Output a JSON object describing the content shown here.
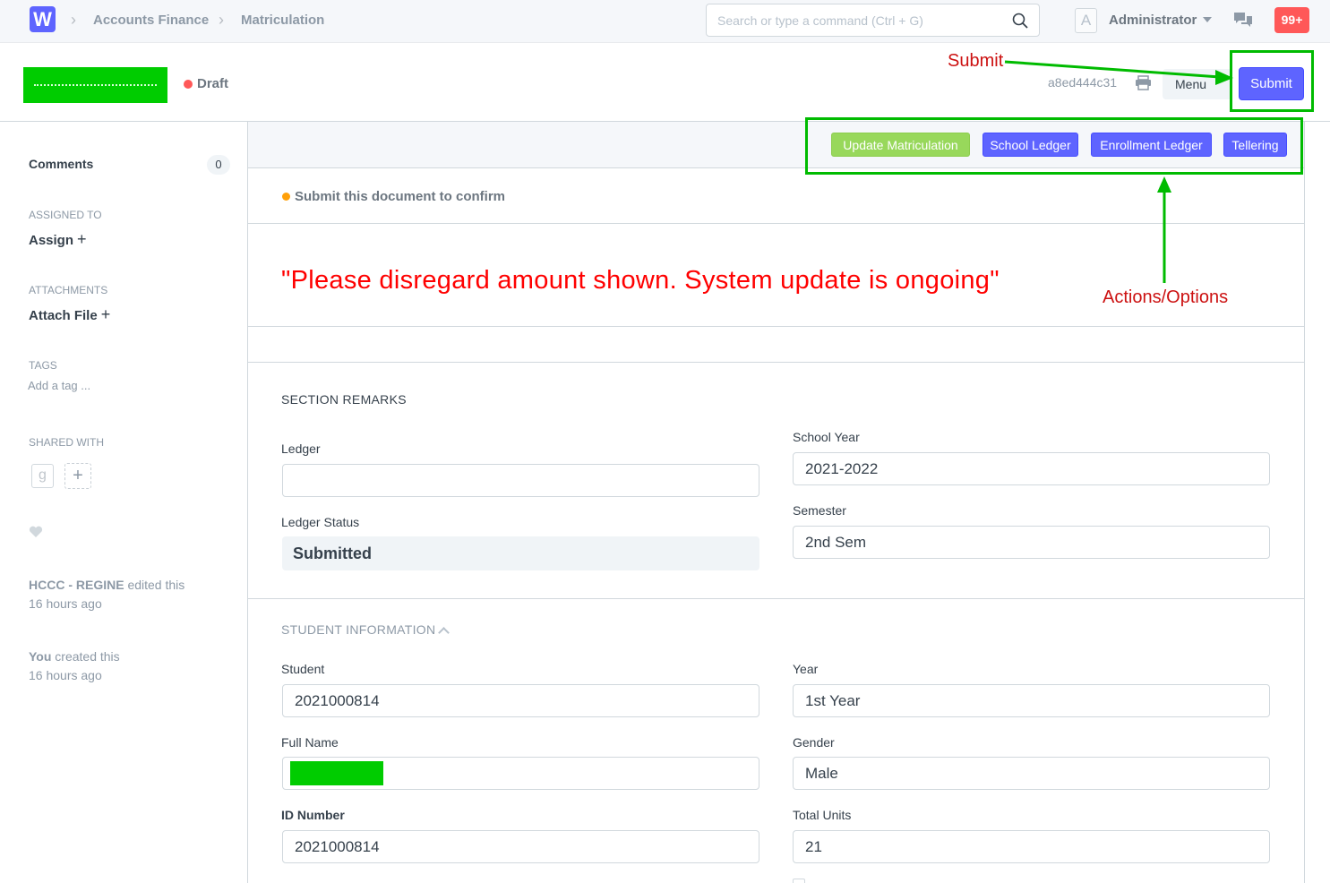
{
  "navbar": {
    "logo": "W",
    "breadcrumbs": [
      "Accounts Finance",
      "Matriculation"
    ],
    "search_placeholder": "Search or type a command (Ctrl + G)",
    "avatar_letter": "A",
    "user_name": "Administrator",
    "notifications": "99+"
  },
  "page_head": {
    "status": "Draft",
    "doc_id": "a8ed444c31",
    "menu_label": "Menu",
    "submit_label": "Submit"
  },
  "sidebar": {
    "comments_label": "Comments",
    "comments_count": "0",
    "assigned_label": "ASSIGNED TO",
    "assign_action": "Assign",
    "attachments_label": "ATTACHMENTS",
    "attach_action": "Attach File",
    "tags_label": "TAGS",
    "tag_placeholder": "Add a tag ...",
    "shared_label": "SHARED WITH",
    "shared_user": "g",
    "timeline": [
      {
        "actor": "HCCC - REGINE",
        "action": "edited this",
        "when": "16 hours ago"
      },
      {
        "actor": "You",
        "action": "created this",
        "when": "16 hours ago"
      }
    ]
  },
  "actions": {
    "update_matriculation": "Update Matriculation",
    "school_ledger": "School Ledger",
    "enrollment_ledger": "Enrollment Ledger",
    "tellering": "Tellering"
  },
  "confirm_message": "Submit this document to confirm",
  "notice": "\"Please disregard amount shown. System update is ongoing\"",
  "section_remarks": {
    "heading": "SECTION REMARKS",
    "ledger_label": "Ledger",
    "ledger_value": "",
    "ledger_status_label": "Ledger Status",
    "ledger_status_value": "Submitted",
    "school_year_label": "School Year",
    "school_year_value": "2021-2022",
    "semester_label": "Semester",
    "semester_value": "2nd Sem"
  },
  "student_info": {
    "heading": "STUDENT INFORMATION",
    "student_label": "Student",
    "student_value": "2021000814",
    "full_name_label": "Full Name",
    "id_number_label": "ID Number",
    "id_number_value": "2021000814",
    "year_label": "Year",
    "year_value": "1st Year",
    "gender_label": "Gender",
    "gender_value": "Male",
    "total_units_label": "Total Units",
    "total_units_value": "21"
  },
  "annotations": {
    "submit_note": "Submit",
    "actions_note": "Actions/Options",
    "box_color": "#00bb00",
    "text_color": "#cc1111"
  },
  "colors": {
    "primary": "#5e64ff",
    "success": "#98d85b",
    "danger": "#ff5858",
    "warning": "#ffa00a",
    "notice": "#ff0000"
  }
}
